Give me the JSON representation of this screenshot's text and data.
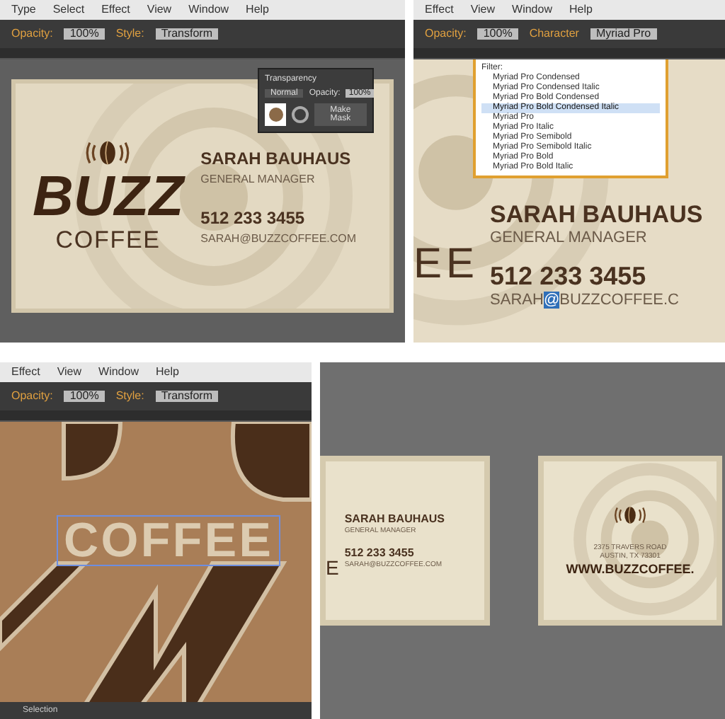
{
  "top_left": {
    "menu": [
      "Type",
      "Select",
      "Effect",
      "View",
      "Window",
      "Help"
    ],
    "toolbar": [
      "Opacity:",
      "100%",
      "Style:",
      "Transform"
    ],
    "transparency_panel": {
      "title": "Transparency",
      "blend_mode": "Normal",
      "opacity_label": "Opacity:",
      "opacity": "100%",
      "button": "Make Mask"
    },
    "card": {
      "logo_word": "BUZZ",
      "logo_sub": "COFFEE",
      "name": "SARAH BAUHAUS",
      "title": "GENERAL MANAGER",
      "phone": "512 233 3455",
      "email": "SARAH@BUZZCOFFEE.COM"
    }
  },
  "top_right": {
    "menu": [
      "Effect",
      "View",
      "Window",
      "Help"
    ],
    "toolbar": [
      "Opacity:",
      "100%",
      "Character",
      "Myriad Pro"
    ],
    "font_menu": {
      "filter_label": "Filter:",
      "fonts": [
        {
          "name": "Myriad Pro Condensed",
          "selected": false
        },
        {
          "name": "Myriad Pro Condensed Italic",
          "selected": false
        },
        {
          "name": "Myriad Pro Bold Condensed",
          "selected": false
        },
        {
          "name": "Myriad Pro Bold Condensed Italic",
          "selected": true
        },
        {
          "name": "Myriad Pro",
          "selected": false
        },
        {
          "name": "Myriad Pro Italic",
          "selected": false
        },
        {
          "name": "Myriad Pro Semibold",
          "selected": false
        },
        {
          "name": "Myriad Pro Semibold Italic",
          "selected": false
        },
        {
          "name": "Myriad Pro Bold",
          "selected": false
        },
        {
          "name": "Myriad Pro Bold Italic",
          "selected": false
        }
      ]
    },
    "card": {
      "logo_part": "EE",
      "name": "SARAH BAUHAUS",
      "title": "GENERAL MANAGER",
      "phone": "512 233 3455",
      "email_user": "SARAH",
      "email_at": "@",
      "email_domain": "BUZZCOFFEE.C"
    }
  },
  "bottom_left": {
    "menu": [
      "Effect",
      "View",
      "Window",
      "Help"
    ],
    "toolbar": [
      "Opacity:",
      "100%",
      "Style:",
      "Transform"
    ],
    "canvas_text": "COFFEE",
    "status": "Selection"
  },
  "bottom_right": {
    "front_card": {
      "logo_part": "E",
      "name": "SARAH BAUHAUS",
      "title": "GENERAL MANAGER",
      "phone": "512 233 3455",
      "email": "SARAH@BUZZCOFFEE.COM"
    },
    "back_card": {
      "address_1": "2375 TRAVERS ROAD",
      "address_2": "AUSTIN, TX 73301",
      "website": "WWW.BUZZCOFFEE."
    }
  }
}
